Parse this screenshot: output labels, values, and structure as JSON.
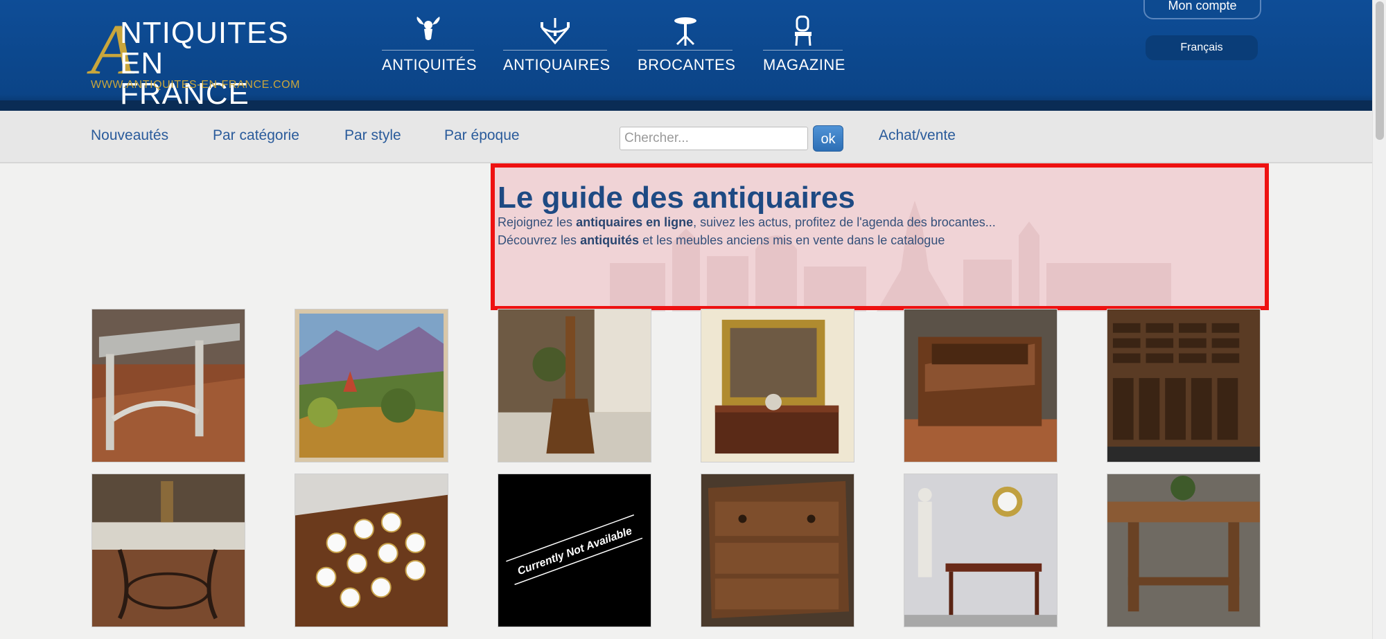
{
  "logo": {
    "line1": "NTIQUITES",
    "line2": "EN FRANCE",
    "initial": "A",
    "url": "WWW.ANTIQUITES-EN-FRANCE.COM",
    "gold": "#c9a63c"
  },
  "nav": {
    "items": [
      {
        "label": "ANTIQUITÉS",
        "icon": "cherub-icon"
      },
      {
        "label": "ANTIQUAIRES",
        "icon": "chandelier-icon"
      },
      {
        "label": "BROCANTES",
        "icon": "pedestal-table-icon"
      },
      {
        "label": "MAGAZINE",
        "icon": "chair-icon"
      }
    ]
  },
  "account": {
    "label": "Mon compte"
  },
  "language": {
    "label": "Français"
  },
  "subnav": {
    "links": [
      "Nouveautés",
      "Par catégorie",
      "Par style",
      "Par époque",
      "Achat/vente"
    ]
  },
  "search": {
    "placeholder": "Chercher...",
    "button_label": "ok"
  },
  "hero": {
    "title": "Le guide des antiquaires",
    "line1": {
      "pre": "Rejoignez les ",
      "bold": "antiquaires en ligne",
      "post": ", suivez les actus, profitez de l'agenda des brocantes..."
    },
    "line2": {
      "pre": "Découvrez les ",
      "bold": "antiquités",
      "post": " et les meubles anciens mis en vente dans le catalogue"
    }
  },
  "grid": {
    "items": [
      {
        "name": "carved-console-table"
      },
      {
        "name": "landscape-painting"
      },
      {
        "name": "carved-wooden-candlestick"
      },
      {
        "name": "gilt-mirror-and-buffet"
      },
      {
        "name": "slant-front-desk"
      },
      {
        "name": "drawer-cabinet-furniture"
      },
      {
        "name": "iron-garden-table"
      },
      {
        "name": "porcelain-cups-set"
      },
      {
        "name": "currently-not-available",
        "text": "Currently Not Available"
      },
      {
        "name": "carved-commode"
      },
      {
        "name": "writing-desk-and-clock"
      },
      {
        "name": "farmhouse-table"
      }
    ]
  },
  "colors": {
    "header": "#0e4d97",
    "link": "#2a5b9b",
    "highlight_border": "#ee1111"
  }
}
